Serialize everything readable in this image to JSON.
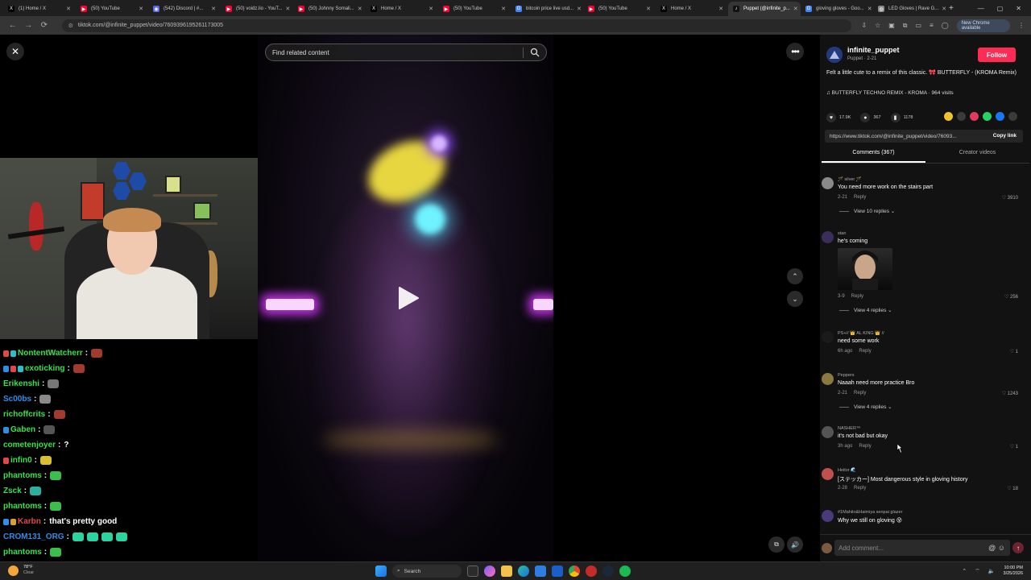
{
  "browser": {
    "tabs": [
      {
        "label": "(1) Home / X",
        "fav_color": "#000000",
        "fav_glyph": "X"
      },
      {
        "label": "(50) YouTube",
        "fav_color": "#ff0033",
        "fav_glyph": "▶"
      },
      {
        "label": "(542) Discord | #...",
        "fav_color": "#5865f2",
        "fav_glyph": "◉"
      },
      {
        "label": "(50) voidz.lio - YouT...",
        "fav_color": "#ff0033",
        "fav_glyph": "▶"
      },
      {
        "label": "(50) Johnny Somali...",
        "fav_color": "#ff0033",
        "fav_glyph": "▶"
      },
      {
        "label": "Home / X",
        "fav_color": "#000000",
        "fav_glyph": "X"
      },
      {
        "label": "(50) YouTube",
        "fav_color": "#ff0033",
        "fav_glyph": "▶"
      },
      {
        "label": "bitcoin price live usd...",
        "fav_color": "#4285f4",
        "fav_glyph": "G"
      },
      {
        "label": "(50) YouTube",
        "fav_color": "#ff0033",
        "fav_glyph": "▶"
      },
      {
        "label": "Home / X",
        "fav_color": "#000000",
        "fav_glyph": "X"
      },
      {
        "label": "Puppet (@infinite_p...",
        "fav_color": "#111111",
        "fav_glyph": "♪",
        "active": true
      },
      {
        "label": "gloving gloves - Goo...",
        "fav_color": "#4285f4",
        "fav_glyph": "G"
      },
      {
        "label": "LED Gloves | Rave G...",
        "fav_color": "#888888",
        "fav_glyph": "◍"
      }
    ],
    "new_tab": "+",
    "url": "tiktok.com/@infinite_puppet/video/7609396195261173005",
    "chrome_update": "New Chrome available"
  },
  "video": {
    "search_placeholder": "Find related content",
    "close_label": "✕",
    "more_label": "•••",
    "nav_up": "⌃",
    "nav_down": "⌄"
  },
  "chat": [
    {
      "user": "NontentWatcherr",
      "color": "#36e34b",
      "badges": [
        "#e34848",
        "#2bc0c9"
      ],
      "text": "",
      "emote": "#a23b2e"
    },
    {
      "user": "exoticking",
      "color": "#36e34b",
      "badges": [
        "#2f8fe8",
        "#e34848",
        "#2bc0c9"
      ],
      "text": "",
      "emote": "#a23b2e"
    },
    {
      "user": "Erikenshi",
      "color": "#36e34b",
      "badges": [],
      "text": "",
      "emote": "#777777"
    },
    {
      "user": "Sc00bs",
      "color": "#2f8fe8",
      "badges": [],
      "text": "",
      "emote": "#8a8a8a"
    },
    {
      "user": "richoffcrits",
      "color": "#36e34b",
      "badges": [],
      "text": "",
      "emote": "#a23b2e"
    },
    {
      "user": "Gaben",
      "color": "#36e34b",
      "badges": [
        "#2f8fe8"
      ],
      "text": "",
      "emote": "#555555"
    },
    {
      "user": "cometenjoyer",
      "color": "#36e34b",
      "badges": [],
      "text": "?",
      "emote": ""
    },
    {
      "user": "infin0",
      "color": "#36e34b",
      "badges": [
        "#e34848"
      ],
      "text": "",
      "emote": "#d8c030"
    },
    {
      "user": "phantoms",
      "color": "#36e34b",
      "badges": [],
      "text": "",
      "emote": "#3cbf4a"
    },
    {
      "user": "Zsck",
      "color": "#36e34b",
      "badges": [],
      "text": "",
      "emote": "#2bb0a0"
    },
    {
      "user": "phantoms",
      "color": "#36e34b",
      "badges": [],
      "text": "",
      "emote": "#3cbf4a"
    },
    {
      "user": "Karbn",
      "color": "#e34848",
      "badges": [
        "#2f8fe8",
        "#d8a030"
      ],
      "text": "that's pretty good",
      "emote": ""
    },
    {
      "user": "CROM131_ORG",
      "color": "#2f8fe8",
      "badges": [],
      "text": "",
      "emote": "#2bd3a0",
      "emote_count": 4
    },
    {
      "user": "phantoms",
      "color": "#36e34b",
      "badges": [],
      "text": "",
      "emote": "#3cbf4a"
    }
  ],
  "panel": {
    "author": "infinite_puppet",
    "author_sub": "Puppet · 2-21",
    "follow": "Follow",
    "caption": "Felt a little cute to a remix of this classic. 🎀 BUTTERFLY - (KROMA Remix)",
    "music": "♫  BUTTERFLY TECHNO REMIX - KROMA · 964 visits",
    "likes": "17.9K",
    "comments_count": "367",
    "saves": "1178",
    "share_colors": [
      "#f2c12e",
      "#3a3a3a",
      "#e23a5c",
      "#25d366",
      "#1877f2",
      "#3a3a3a"
    ],
    "link": "https://www.tiktok.com/@infinite_puppet/video/76093...",
    "copy_link": "Copy link",
    "tab_comments": "Comments (367)",
    "tab_creator": "Creator videos",
    "comments": [
      {
        "user": "🪄 silver 🪄",
        "text": "You need more work on the stairs part",
        "date": "2-21",
        "reply": "Reply",
        "likes": "♡ 3910",
        "replies": "View 10 replies ⌄",
        "av": "#8a8a8a"
      },
      {
        "user": "stan",
        "text": "he's coming",
        "date": "3-9",
        "reply": "Reply",
        "likes": "♡ 256",
        "replies": "View 4 replies ⌄",
        "av": "#3b2e5a",
        "has_image": true
      },
      {
        "user": "PS+// 👑 AL KING 👑 //",
        "text": "need some work",
        "date": "6h ago",
        "reply": "Reply",
        "likes": "♡ 1",
        "replies": "",
        "av": "#1a1a1a"
      },
      {
        "user": "Peppers",
        "text": "Naaah need more practice Bro",
        "date": "2-21",
        "reply": "Reply",
        "likes": "♡ 1243",
        "replies": "View 4 replies ⌄",
        "av": "#8a7a40"
      },
      {
        "user": "NASHER™",
        "text": "it's not bad but okay",
        "date": "3h ago",
        "reply": "Reply",
        "likes": "♡ 1",
        "replies": "",
        "av": "#555555"
      },
      {
        "user": "Heitor 🌊",
        "text": "[ステッカー] Most dangerous style in gloving history",
        "date": "2-28",
        "reply": "Reply",
        "likes": "♡ 18",
        "replies": "",
        "av": "#c0504d"
      },
      {
        "user": "#1Mahito&Haimiya senpai glazer",
        "text": "Why we still on gloving 😵",
        "date": "",
        "reply": "",
        "likes": "",
        "replies": "",
        "av": "#4a3a7a"
      }
    ],
    "add_comment": "Add comment...",
    "cb_icons": "@ ☺",
    "send": "↑"
  },
  "taskbar": {
    "temp": "78°F",
    "weather": "Clear",
    "search": "Search",
    "time": "10:00 PM",
    "date": "3/25/2026"
  }
}
